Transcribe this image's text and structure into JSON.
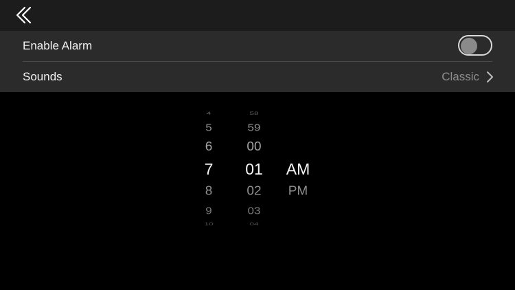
{
  "nav": {
    "back_icon": "chevron-left-icon"
  },
  "settings": {
    "enable_alarm_label": "Enable Alarm",
    "enable_alarm_on": false,
    "sounds_label": "Sounds",
    "sounds_value": "Classic"
  },
  "picker": {
    "hours": [
      "4",
      "5",
      "6",
      "7",
      "8",
      "9",
      "10"
    ],
    "minutes": [
      "58",
      "59",
      "00",
      "01",
      "02",
      "03",
      "04"
    ],
    "periods": [
      "AM",
      "PM"
    ],
    "selected": {
      "hour": "7",
      "minute": "01",
      "period": "AM"
    }
  },
  "colors": {
    "background": "#000000",
    "group_bg": "#2b2b2b",
    "text_primary": "#f2f2f2",
    "text_secondary": "#8e8e8e"
  }
}
